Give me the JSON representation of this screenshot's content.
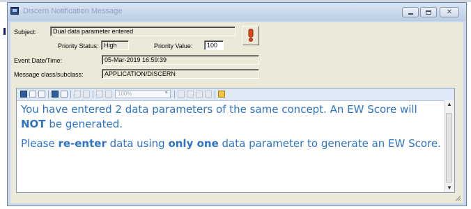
{
  "window": {
    "title": "Discern Notification Message"
  },
  "fields": {
    "subject_label": "Subject:",
    "subject_value": "Dual data parameter entered",
    "priority_status_label": "Priority Status:",
    "priority_status_value": "High",
    "priority_value_label": "Priority Value:",
    "priority_value_value": "100",
    "event_label": "Event Date/Time:",
    "event_value": "05-Mar-2019 16:59:39",
    "class_label": "Message class/subclass:",
    "class_value": "APPLICATION/DISCERN"
  },
  "toolbar": {
    "zoom": "100%"
  },
  "message": {
    "p1_a": "You have entered 2 data parameters of the same concept. An EW Score will ",
    "p1_bold": "NOT",
    "p1_b": " be generated.",
    "p2_a": "Please ",
    "p2_bold1": "re-enter",
    "p2_b": " data using ",
    "p2_bold2": "only one",
    "p2_c": " data parameter to generate an EW Score."
  },
  "colors": {
    "message_text": "#2e73c7",
    "window_frame": "#c9d8ea",
    "dialog_body": "#ece9d8",
    "priority_icon": "#e04a1c"
  }
}
